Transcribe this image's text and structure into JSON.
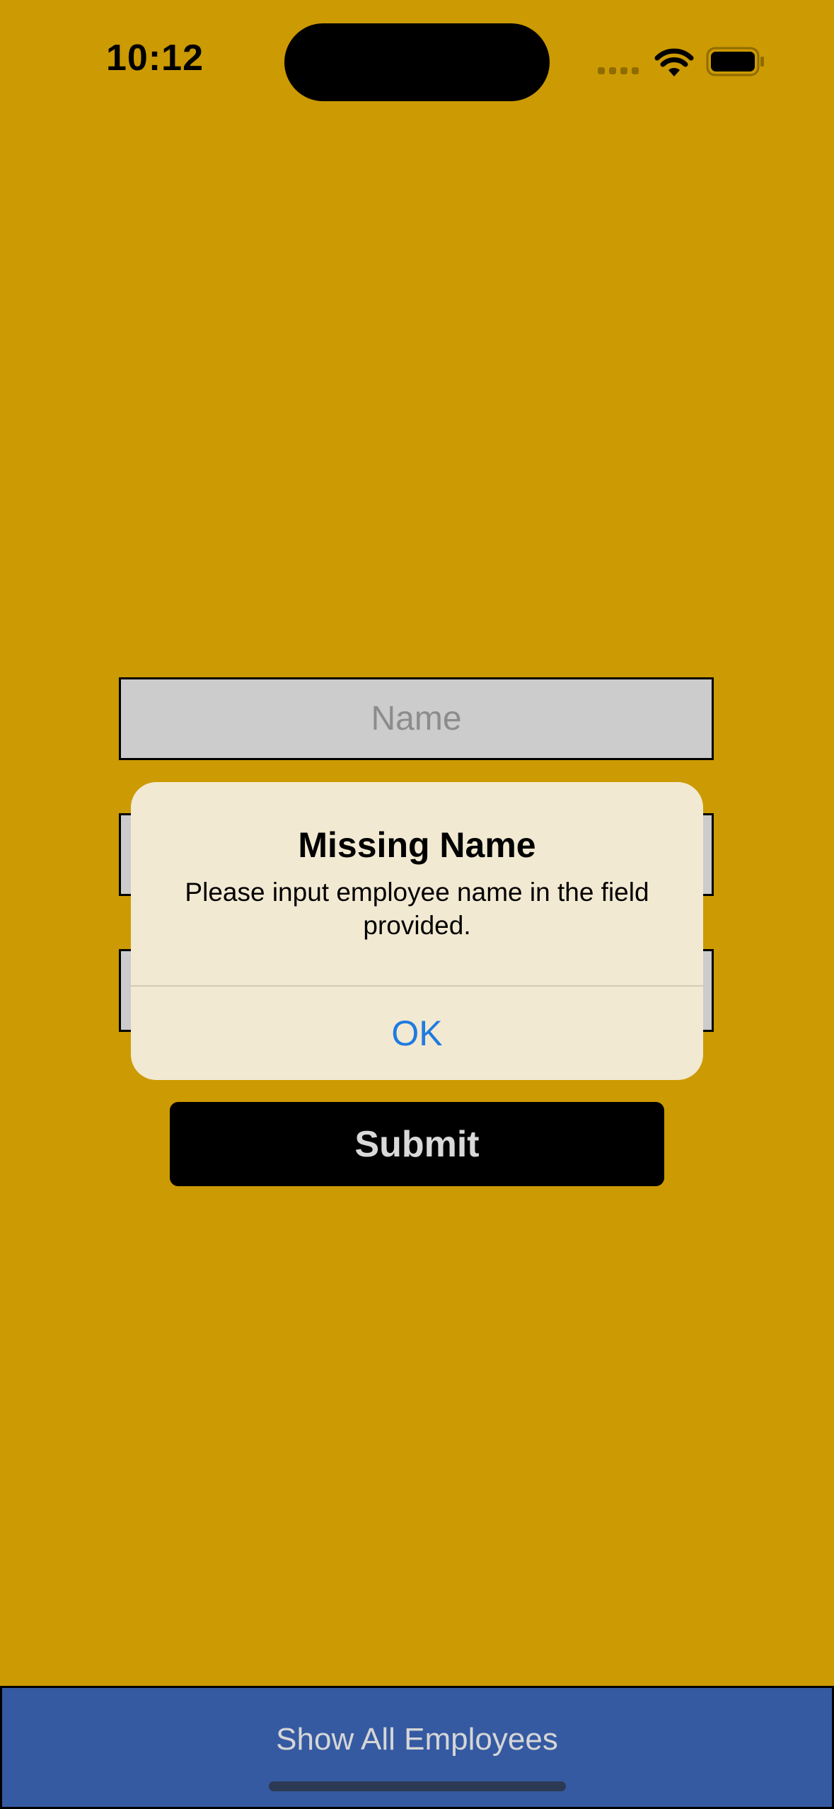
{
  "status_bar": {
    "time": "10:12"
  },
  "form": {
    "name_placeholder": "Name",
    "submit_label": "Submit"
  },
  "alert": {
    "title": "Missing Name",
    "message": "Please input employee name in the field provided.",
    "ok_label": "OK"
  },
  "bottom_bar": {
    "label": "Show All Employees"
  },
  "colors": {
    "background": "#CC9A02",
    "field": "#CCCCCC",
    "alert_background": "#F2E9D2",
    "alert_action": "#1F7BE0",
    "bottom_bar": "#355AA2",
    "submit_button": "#000000"
  },
  "icons": [
    "signal-icon",
    "wifi-icon",
    "battery-icon"
  ]
}
